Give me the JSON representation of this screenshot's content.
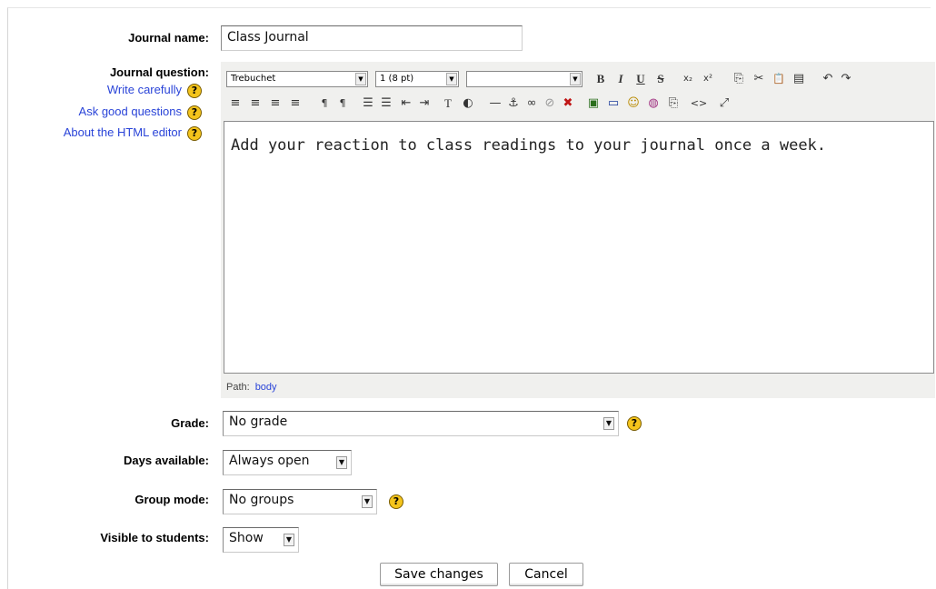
{
  "form": {
    "journal_name_label": "Journal name:",
    "journal_name_value": "Class Journal",
    "journal_question_label": "Journal question:",
    "help_links": [
      "Write carefully",
      "Ask good questions",
      "About the HTML editor"
    ],
    "help_glyph": "?",
    "editor": {
      "font_select": "Trebuchet",
      "size_select": "1 (8 pt)",
      "style_select": "",
      "content": "Add your reaction to class readings to your journal once a week.",
      "path_label": "Path:",
      "path_value": "body",
      "toolbar_row1": [
        "B",
        "I",
        "U",
        "S",
        "x₂",
        "x²",
        "⎘",
        "✂",
        "📋",
        "▤",
        "↶",
        "↷"
      ],
      "toolbar_row2": [
        "≡",
        "≡",
        "≡",
        "≡",
        "¶",
        "¶",
        "☰",
        "☰",
        "⇤",
        "⇥",
        "T",
        "◐",
        "—",
        "⚓",
        "∞",
        "⊘",
        "✖",
        "▣",
        "▭",
        "☺",
        "◍",
        "⎘",
        "<>",
        "⤢"
      ]
    },
    "grade_label": "Grade:",
    "grade_value": "No grade",
    "days_label": "Days available:",
    "days_value": "Always open",
    "group_label": "Group mode:",
    "group_value": "No groups",
    "visible_label": "Visible to students:",
    "visible_value": "Show",
    "save_button": "Save changes",
    "cancel_button": "Cancel"
  }
}
